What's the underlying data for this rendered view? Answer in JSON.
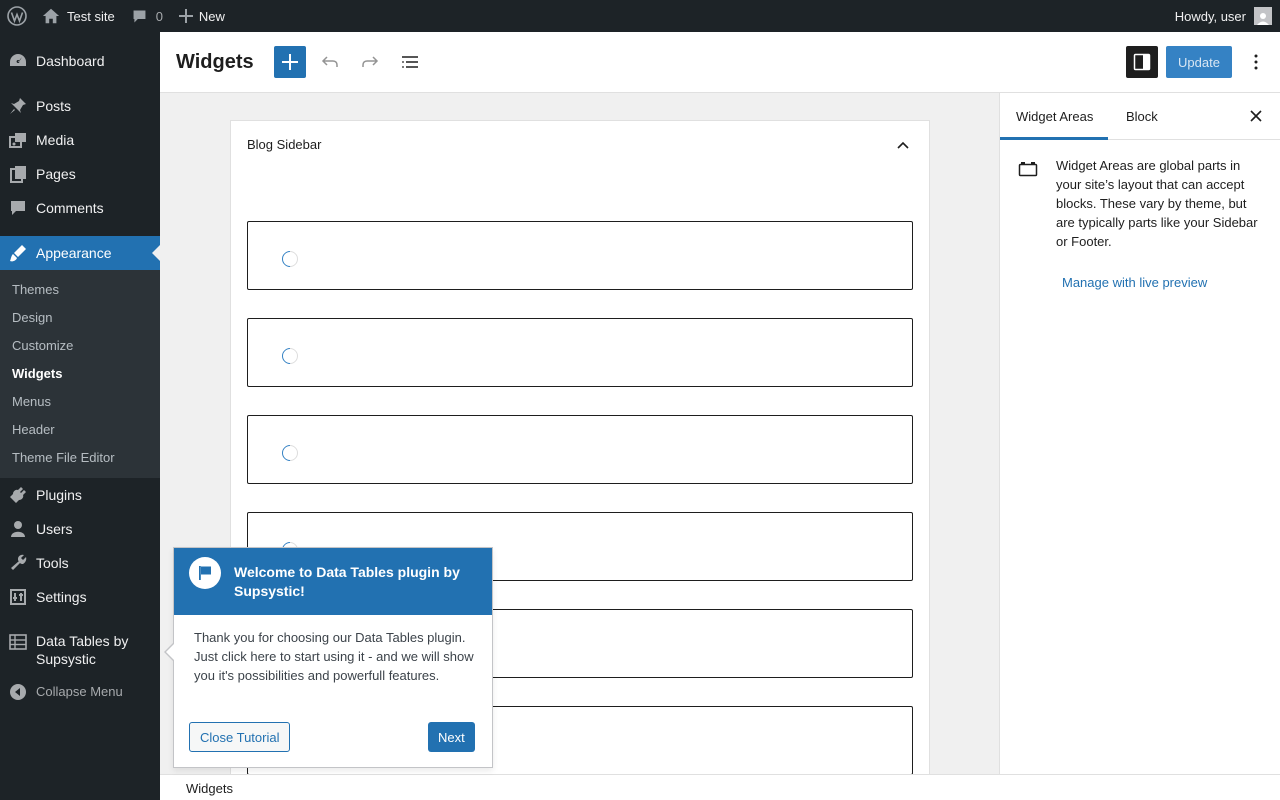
{
  "admin_bar": {
    "site_name": "Test site",
    "comments_count": "0",
    "new_label": "New",
    "greeting": "Howdy, user"
  },
  "admin_menu": {
    "items": [
      {
        "label": "Dashboard",
        "icon": "dashboard-icon"
      },
      {
        "label": "Posts",
        "icon": "pushpin-icon"
      },
      {
        "label": "Media",
        "icon": "media-icon"
      },
      {
        "label": "Pages",
        "icon": "pages-icon"
      },
      {
        "label": "Comments",
        "icon": "comment-icon"
      },
      {
        "label": "Appearance",
        "icon": "paintbrush-icon"
      },
      {
        "label": "Plugins",
        "icon": "plug-icon"
      },
      {
        "label": "Users",
        "icon": "user-icon"
      },
      {
        "label": "Tools",
        "icon": "wrench-icon"
      },
      {
        "label": "Settings",
        "icon": "settings-icon"
      },
      {
        "label": "Data Tables by Supsystic",
        "icon": "table-icon"
      },
      {
        "label": "Collapse Menu",
        "icon": "collapse-icon"
      }
    ],
    "appearance_submenu": [
      "Themes",
      "Design",
      "Customize",
      "Widgets",
      "Menus",
      "Header",
      "Theme File Editor"
    ],
    "current_submenu": "Widgets"
  },
  "editor": {
    "title": "Widgets",
    "update_label": "Update"
  },
  "canvas": {
    "widget_area_title": "Blog Sidebar"
  },
  "sidebar": {
    "tabs": [
      "Widget Areas",
      "Block"
    ],
    "active_tab": "Widget Areas",
    "description": "Widget Areas are global parts in your site’s layout that can accept blocks. These vary by theme, but are typically parts like your Sidebar or Footer.",
    "link": "Manage with live preview"
  },
  "footer": {
    "breadcrumb": "Widgets"
  },
  "tutorial": {
    "title": "Welcome to Data Tables plugin by Supsystic!",
    "body": "Thank you for choosing our Data Tables plugin. Just click here to start using it - and we will show you it's possibilities and powerfull features.",
    "close_label": "Close Tutorial",
    "next_label": "Next"
  },
  "colors": {
    "accent": "#2271b1",
    "admin_bg": "#1d2327",
    "submenu_bg": "#2c3338"
  }
}
